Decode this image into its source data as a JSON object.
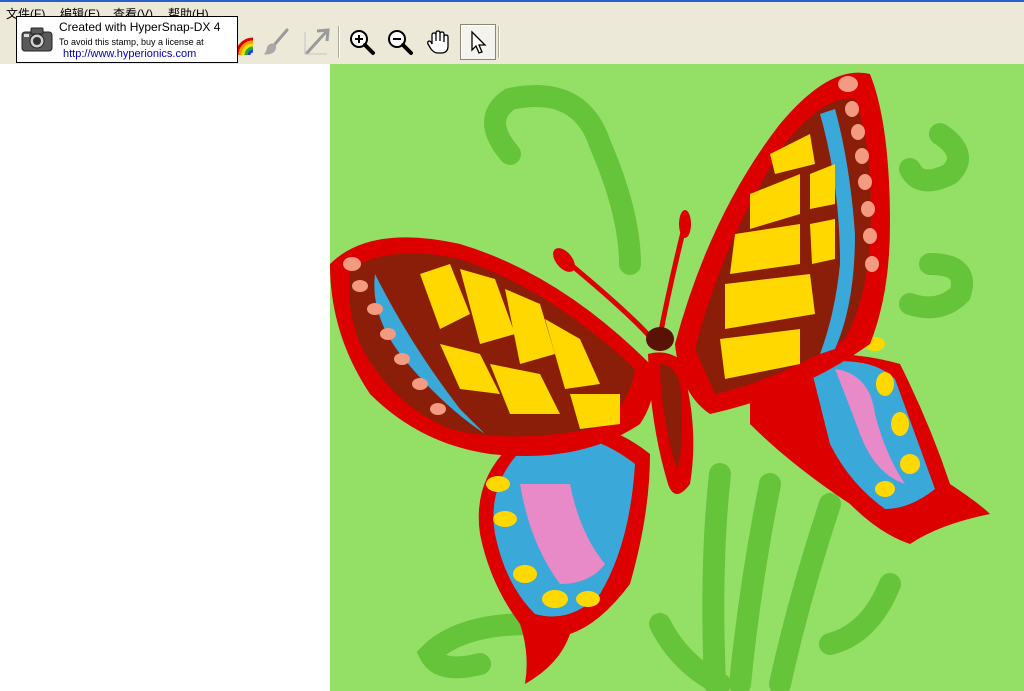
{
  "menu": {
    "file": "文件(F)",
    "edit": "编辑(E)",
    "view": "查看(V)",
    "help": "帮助(H)"
  },
  "toolbar": {
    "buttons": [
      "pencil-tool",
      "brush-tool",
      "line-tool",
      "zoom-in",
      "zoom-out",
      "hand-pan",
      "select-pointer"
    ],
    "active": "select-pointer"
  },
  "stamp": {
    "line1": "Created with HyperSnap-DX 4",
    "line2": "To avoid this stamp, buy a license at",
    "line3": "http://www.hyperionics.com"
  },
  "image": {
    "subject": "butterfly-clipart",
    "colors": {
      "background": "#94e066",
      "leaves": "#66c43a",
      "outline": "#dd0000",
      "yellow": "#ffd800",
      "brown": "#8a1e08",
      "blue": "#3aa8d8",
      "pink": "#e88ac8",
      "salmon": "#f39a80"
    }
  }
}
